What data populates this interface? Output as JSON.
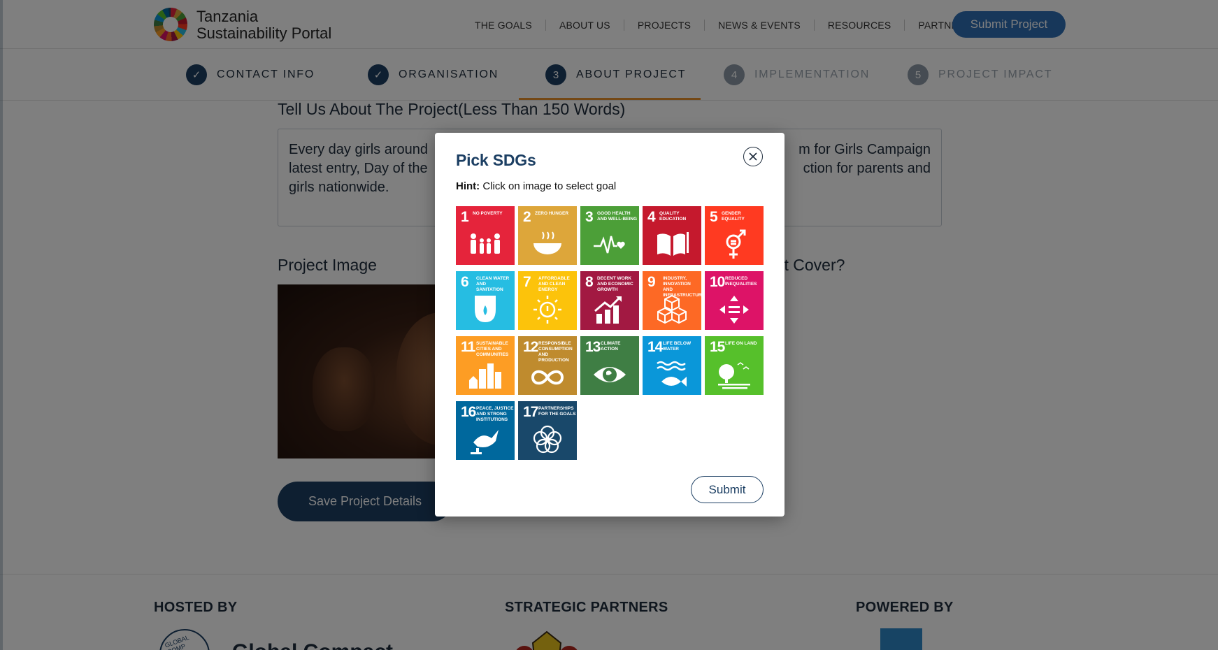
{
  "header": {
    "brand_line1": "Tanzania",
    "brand_line2": "Sustainability Portal",
    "nav": [
      "THE GOALS",
      "ABOUT US",
      "PROJECTS",
      "NEWS & EVENTS",
      "RESOURCES",
      "PARTNERS"
    ],
    "submit_label": "Submit Project"
  },
  "steps": [
    {
      "marker": "✓",
      "label": "CONTACT INFO",
      "state": "done"
    },
    {
      "marker": "✓",
      "label": "ORGANISATION",
      "state": "done"
    },
    {
      "marker": "3",
      "label": "ABOUT PROJECT",
      "state": "active"
    },
    {
      "marker": "4",
      "label": "IMPLEMENTATION",
      "state": "pending"
    },
    {
      "marker": "5",
      "label": "PROJECT IMPACT",
      "state": "pending"
    }
  ],
  "form": {
    "about_title": "Tell Us About The Project(Less Than 150 Words)",
    "about_text_left_1": "Every day girls around",
    "about_text_right_1": "m for Girls Campaign",
    "about_text_left_2": "latest entry, Day of the",
    "about_text_right_2": "ction for parents and",
    "about_text_left_3": "girls nationwide.",
    "image_title": "Project Image",
    "cover_title_fragment": "ct Cover?",
    "save_label": "Save Project Details"
  },
  "footer": {
    "hosted_by": "HOSTED BY",
    "strategic_partners": "STRATEGIC PARTNERS",
    "powered_by": "POWERED BY",
    "gc_text": "Global Compact",
    "gc_ring_text": "GLOBAL COMP"
  },
  "modal": {
    "title": "Pick SDGs",
    "hint_label": "Hint:",
    "hint_text": " Click on image to select goal",
    "close_icon": "close-icon",
    "submit_label": "Submit",
    "goals": [
      {
        "number": "1",
        "label": "NO POVERTY",
        "color": "#e5243b",
        "icon": "family-icon"
      },
      {
        "number": "2",
        "label": "ZERO HUNGER",
        "color": "#dda63a",
        "icon": "bowl-icon"
      },
      {
        "number": "3",
        "label": "GOOD HEALTH AND WELL-BEING",
        "color": "#4c9f38",
        "icon": "heartbeat-icon"
      },
      {
        "number": "4",
        "label": "QUALITY EDUCATION",
        "color": "#c5192d",
        "icon": "book-icon"
      },
      {
        "number": "5",
        "label": "GENDER EQUALITY",
        "color": "#ff3a21",
        "icon": "gender-icon"
      },
      {
        "number": "6",
        "label": "CLEAN WATER AND SANITATION",
        "color": "#26bde2",
        "icon": "water-icon"
      },
      {
        "number": "7",
        "label": "AFFORDABLE AND CLEAN ENERGY",
        "color": "#fcc30b",
        "icon": "sun-icon"
      },
      {
        "number": "8",
        "label": "DECENT WORK AND ECONOMIC GROWTH",
        "color": "#a21942",
        "icon": "growth-chart-icon"
      },
      {
        "number": "9",
        "label": "INDUSTRY, INNOVATION AND INFRASTRUCTURE",
        "color": "#fd6925",
        "icon": "cubes-icon"
      },
      {
        "number": "10",
        "label": "REDUCED INEQUALITIES",
        "color": "#dd1367",
        "icon": "equal-arrows-icon"
      },
      {
        "number": "11",
        "label": "SUSTAINABLE CITIES AND COMMUNITIES",
        "color": "#fd9d24",
        "icon": "city-icon"
      },
      {
        "number": "12",
        "label": "RESPONSIBLE CONSUMPTION AND PRODUCTION",
        "color": "#bf8b2e",
        "icon": "infinity-icon"
      },
      {
        "number": "13",
        "label": "CLIMATE ACTION",
        "color": "#3f7e44",
        "icon": "eye-globe-icon"
      },
      {
        "number": "14",
        "label": "LIFE BELOW WATER",
        "color": "#0a97d9",
        "icon": "fish-icon"
      },
      {
        "number": "15",
        "label": "LIFE ON LAND",
        "color": "#56c02b",
        "icon": "tree-icon"
      },
      {
        "number": "16",
        "label": "PEACE, JUSTICE AND STRONG INSTITUTIONS",
        "color": "#00689d",
        "icon": "dove-icon"
      },
      {
        "number": "17",
        "label": "PARTNERSHIPS FOR THE GOALS",
        "color": "#19486a",
        "icon": "rings-icon"
      }
    ]
  }
}
